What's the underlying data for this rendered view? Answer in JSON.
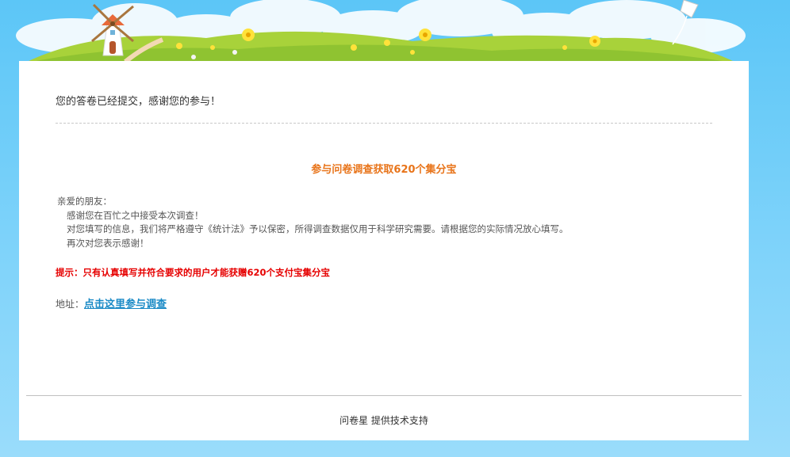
{
  "confirmation": {
    "text": "您的答卷已经提交，感谢您的参与！"
  },
  "promo": {
    "headline": "参与问卷调查获取620个集分宝",
    "greeting": "亲爱的朋友：",
    "line1": "感谢您在百忙之中接受本次调查！",
    "line2": "对您填写的信息，我们将严格遵守《统计法》予以保密，所得调查数据仅用于科学研究需要。请根据您的实际情况放心填写。",
    "line3": "再次对您表示感谢！",
    "tip": "提示：只有认真填写并符合要求的用户才能获赠620个支付宝集分宝",
    "address_label": "地址：",
    "link_text": "点击这里参与调查"
  },
  "footer": {
    "text": "问卷星 提供技术支持"
  },
  "colors": {
    "headline": "#e8741a",
    "tip": "#e60000",
    "link": "#1a8ac6",
    "sky": "#5cc6f7",
    "grass": "#a8d23a"
  },
  "icons": [
    "windmill-icon",
    "kite-icon",
    "flower-icon"
  ]
}
